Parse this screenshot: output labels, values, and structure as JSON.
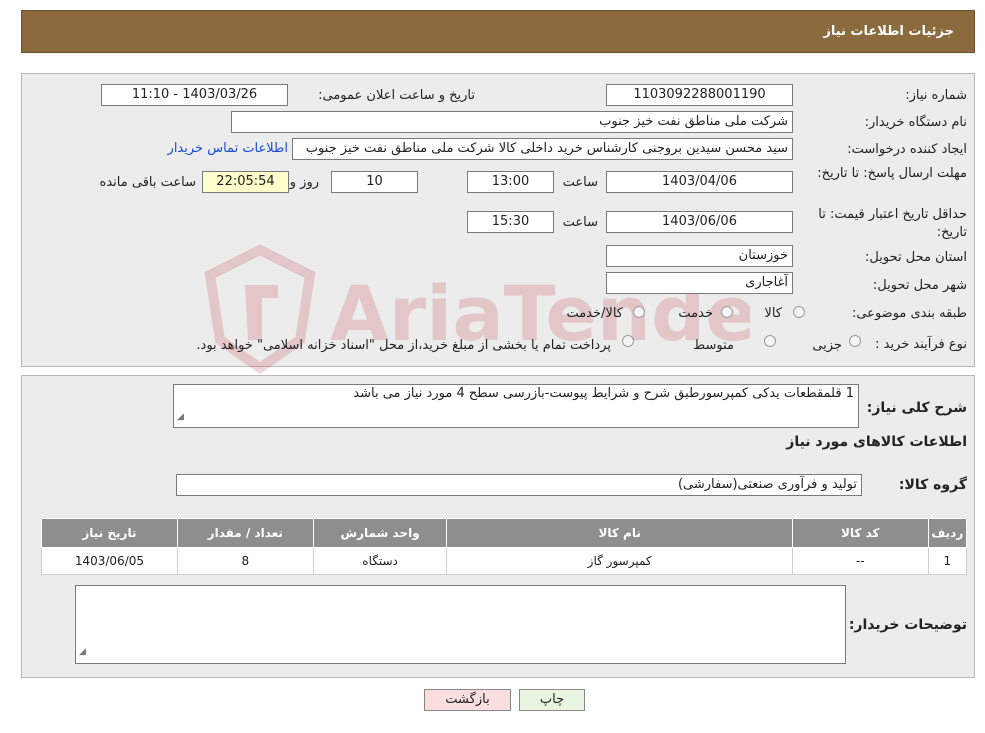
{
  "header": {
    "title": "جزئیات اطلاعات نیاز"
  },
  "form": {
    "need_number_label": "شماره نیاز:",
    "need_number": "1103092288001190",
    "announce_label": "تاریخ و ساعت اعلان عمومی:",
    "announce_value": "1403/03/26 - 11:10",
    "buyer_label": "نام دستگاه خریدار:",
    "buyer_value": "شرکت ملی مناطق نفت خیز جنوب",
    "creator_label": "ایجاد کننده درخواست:",
    "creator_value": "سید محسن  سیدین بروجنی  کارشناس خرید داخلی کالا  شرکت ملی مناطق نفت خیز جنوب",
    "contact_link": "اطلاعات تماس خریدار",
    "deadline_label": "مهلت ارسال پاسخ: تا تاریخ:",
    "deadline_date": "1403/04/06",
    "time_label": "ساعت",
    "deadline_time": "13:00",
    "days_value": "10",
    "days_label": "روز و",
    "remaining_time": "22:05:54",
    "remaining_label": "ساعت باقی مانده",
    "validity_label": "حداقل تاریخ اعتبار قیمت: تا تاریخ:",
    "validity_date": "1403/06/06",
    "validity_time_label": "ساعت",
    "validity_time": "15:30",
    "province_label": "استان محل تحویل:",
    "province_value": "خوزستان",
    "city_label": "شهر محل تحویل:",
    "city_value": "آغاجاری",
    "category_label": "طبقه بندی موضوعی:",
    "category_options": [
      "کالا",
      "خدمت",
      "کالا/خدمت"
    ],
    "process_label": "نوع فرآیند خرید :",
    "process_options": [
      "جزیی",
      "متوسط"
    ],
    "process_note": "پرداخت تمام یا بخشی از مبلغ خرید،از محل \"اسناد خزانه اسلامی\" خواهد بود."
  },
  "details": {
    "summary_label": "شرح کلی نیاز:",
    "summary_value": "1 قلمقطعات یدکی کمپرسورطبق شرح و شرایط پیوست-بازرسی سطح 4 مورد نیاز می باشد",
    "goods_info_title": "اطلاعات کالاهای مورد نیاز",
    "goods_group_label": "گروه کالا:",
    "goods_group_value": "تولید و فرآوری صنعتی(سفارشی)",
    "table": {
      "headers": [
        "ردیف",
        "کد کالا",
        "نام کالا",
        "واحد شمارش",
        "تعداد / مقدار",
        "تاریخ نیاز"
      ],
      "rows": [
        [
          "1",
          "--",
          "کمپرسور گاز",
          "دستگاه",
          "8",
          "1403/06/05"
        ]
      ]
    },
    "buyer_notes_label": "توضیحات خریدار:",
    "buyer_notes_value": ""
  },
  "buttons": {
    "print": "چاپ",
    "back": "بازگشت"
  },
  "watermark": {
    "text": "AriaTender.neT"
  },
  "colors": {
    "header_bg": "#8b6a3e",
    "panel_bg": "#ececec",
    "table_header": "#8e8e8e",
    "link": "#1a4bd6",
    "print_button": "#e7f5e1",
    "back_button": "#f8dede",
    "watermark": "#c0262c"
  }
}
